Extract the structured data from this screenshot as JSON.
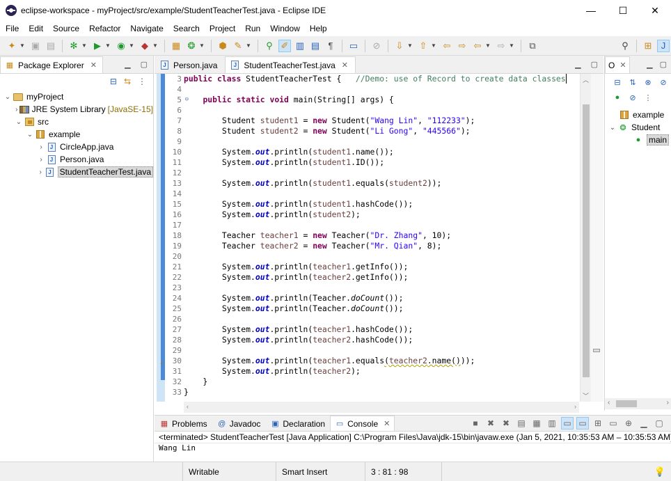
{
  "window": {
    "title": "eclipse-workspace - myProject/src/example/StudentTeacherTest.java - Eclipse IDE",
    "controls": [
      "—",
      "☐",
      "✕"
    ]
  },
  "menu": [
    "File",
    "Edit",
    "Source",
    "Refactor",
    "Navigate",
    "Search",
    "Project",
    "Run",
    "Window",
    "Help"
  ],
  "package_explorer": {
    "tab_label": "Package Explorer",
    "tree": {
      "project": "myProject",
      "jre": "JRE System Library",
      "jre_suffix": "[JavaSE-15]",
      "src": "src",
      "package": "example",
      "files": [
        "CircleApp.java",
        "Person.java",
        "StudentTeacherTest.java"
      ]
    }
  },
  "editor": {
    "tabs": [
      "Person.java",
      "StudentTeacherTest.java"
    ],
    "active_tab": "StudentTeacherTest.java",
    "line_numbers": [
      "3",
      "4",
      "5",
      "6",
      "7",
      "8",
      "9",
      "10",
      "11",
      "12",
      "13",
      "14",
      "15",
      "16",
      "17",
      "18",
      "19",
      "20",
      "21",
      "22",
      "23",
      "24",
      "25",
      "26",
      "27",
      "28",
      "29",
      "30",
      "31",
      "32",
      "33"
    ],
    "code": {
      "l3_comment": "//Demo: use of Record to create data classes",
      "s_wang": "\"Wang Lin\"",
      "s_112233": "\"112233\"",
      "s_li": "\"Li Gong\"",
      "s_445566": "\"445566\"",
      "s_zhang": "\"Dr. Zhang\"",
      "s_qian": "\"Mr. Qian\""
    }
  },
  "outline": {
    "tab_label": "O",
    "items": [
      "example",
      "Student",
      "main"
    ]
  },
  "console_panel": {
    "tabs": [
      "Problems",
      "Javadoc",
      "Declaration",
      "Console"
    ],
    "active_tab": "Console",
    "header": "<terminated> StudentTeacherTest [Java Application] C:\\Program Files\\Java\\jdk-15\\bin\\javaw.exe  (Jan 5, 2021, 10:35:53 AM – 10:35:53 AM)",
    "output_first_line": "Wang Lin"
  },
  "status": {
    "writable": "Writable",
    "insert_mode": "Smart Insert",
    "position": "3 : 81 : 98"
  }
}
